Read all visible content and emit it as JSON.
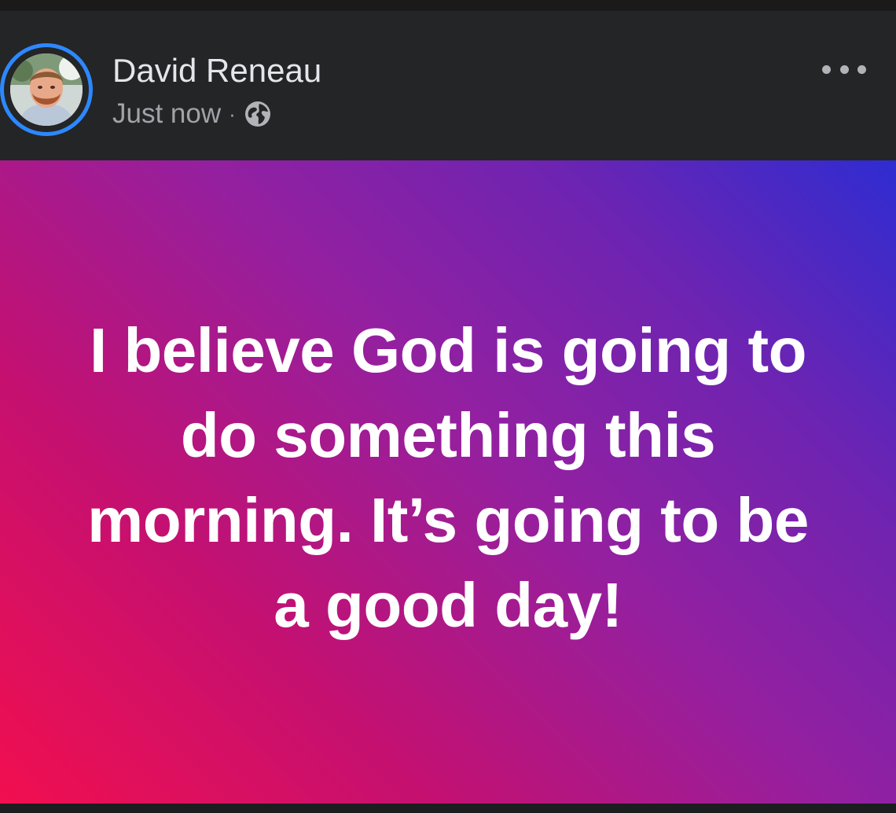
{
  "post": {
    "author_name": "David Reneau",
    "timestamp": "Just now",
    "separator": "·",
    "audience_icon": "globe-icon",
    "more_icon": "more-options-icon",
    "text": "I believe God is going to do something this morning. It’s going to be a good day!",
    "background_gradient": [
      "#f10f4f",
      "#c51070",
      "#9420a0",
      "#6c24b2",
      "#2f2cd1"
    ],
    "avatar_ring_color": "#2d88ff"
  }
}
